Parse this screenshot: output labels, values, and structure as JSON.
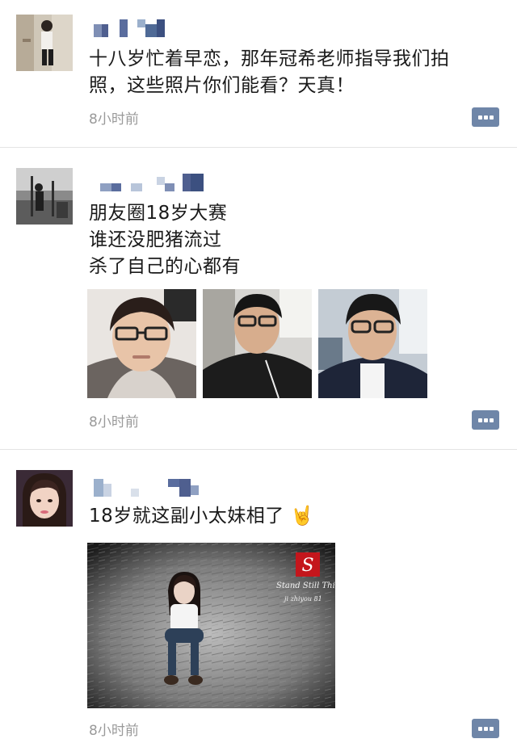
{
  "posts": [
    {
      "text_line1": "十八岁忙着早恋，那年冠希老师指导我们拍",
      "text_line2": "照，这些照片你们能看？天真！",
      "time": "8小时前",
      "avatar_icon": "avatar-photo-icon",
      "comment_icon": "comment-dots-icon"
    },
    {
      "text_line1": "朋友圈18岁大赛",
      "text_line2": "谁还没肥猪流过",
      "text_line3": "杀了自己的心都有",
      "time": "8小时前",
      "comment_icon": "comment-dots-icon"
    },
    {
      "text_line1": "18岁就这副小太妹相了",
      "emoji": "🤘",
      "time": "8小时前",
      "photo_caption_line1": "Stand Still Thin",
      "photo_caption_line2": "ji zhiyou 81",
      "comment_icon": "comment-dots-icon"
    }
  ],
  "colors": {
    "comment_button": "#6f86a8",
    "time_text": "#9a9a9a",
    "divider": "#e4e4e4",
    "mosaic_blue": "#5a6d9e"
  }
}
